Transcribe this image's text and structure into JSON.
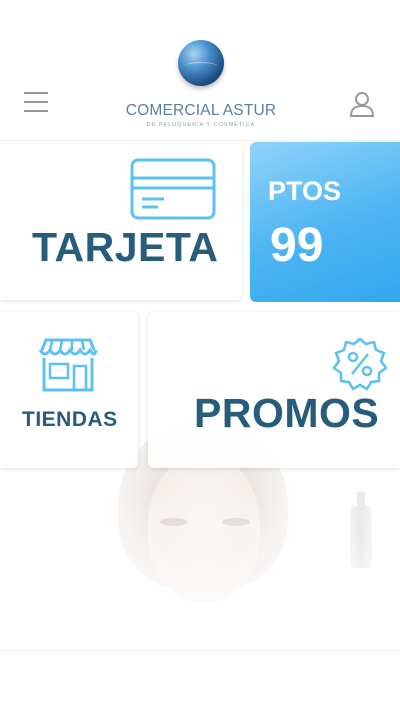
{
  "header": {
    "brand_name": "COMERCIAL ASTUR",
    "brand_tagline": "DE PELUQUERÍA Y COSMÉTICA",
    "menu_icon": "hamburger-icon",
    "user_icon": "user-icon"
  },
  "tiles": {
    "tarjeta": {
      "label": "TARJETA",
      "icon": "credit-card-icon"
    },
    "points": {
      "label": "PTOS",
      "value": "99"
    },
    "tiendas": {
      "label": "TIENDAS",
      "icon": "store-icon"
    },
    "promos": {
      "label": "PROMOS",
      "icon": "discount-badge-icon"
    }
  },
  "colors": {
    "accent_blue": "#3aabf0",
    "tile_text": "#275d7b",
    "icon_blue": "#5cc0f3",
    "header_gray": "#9a9a9a"
  }
}
